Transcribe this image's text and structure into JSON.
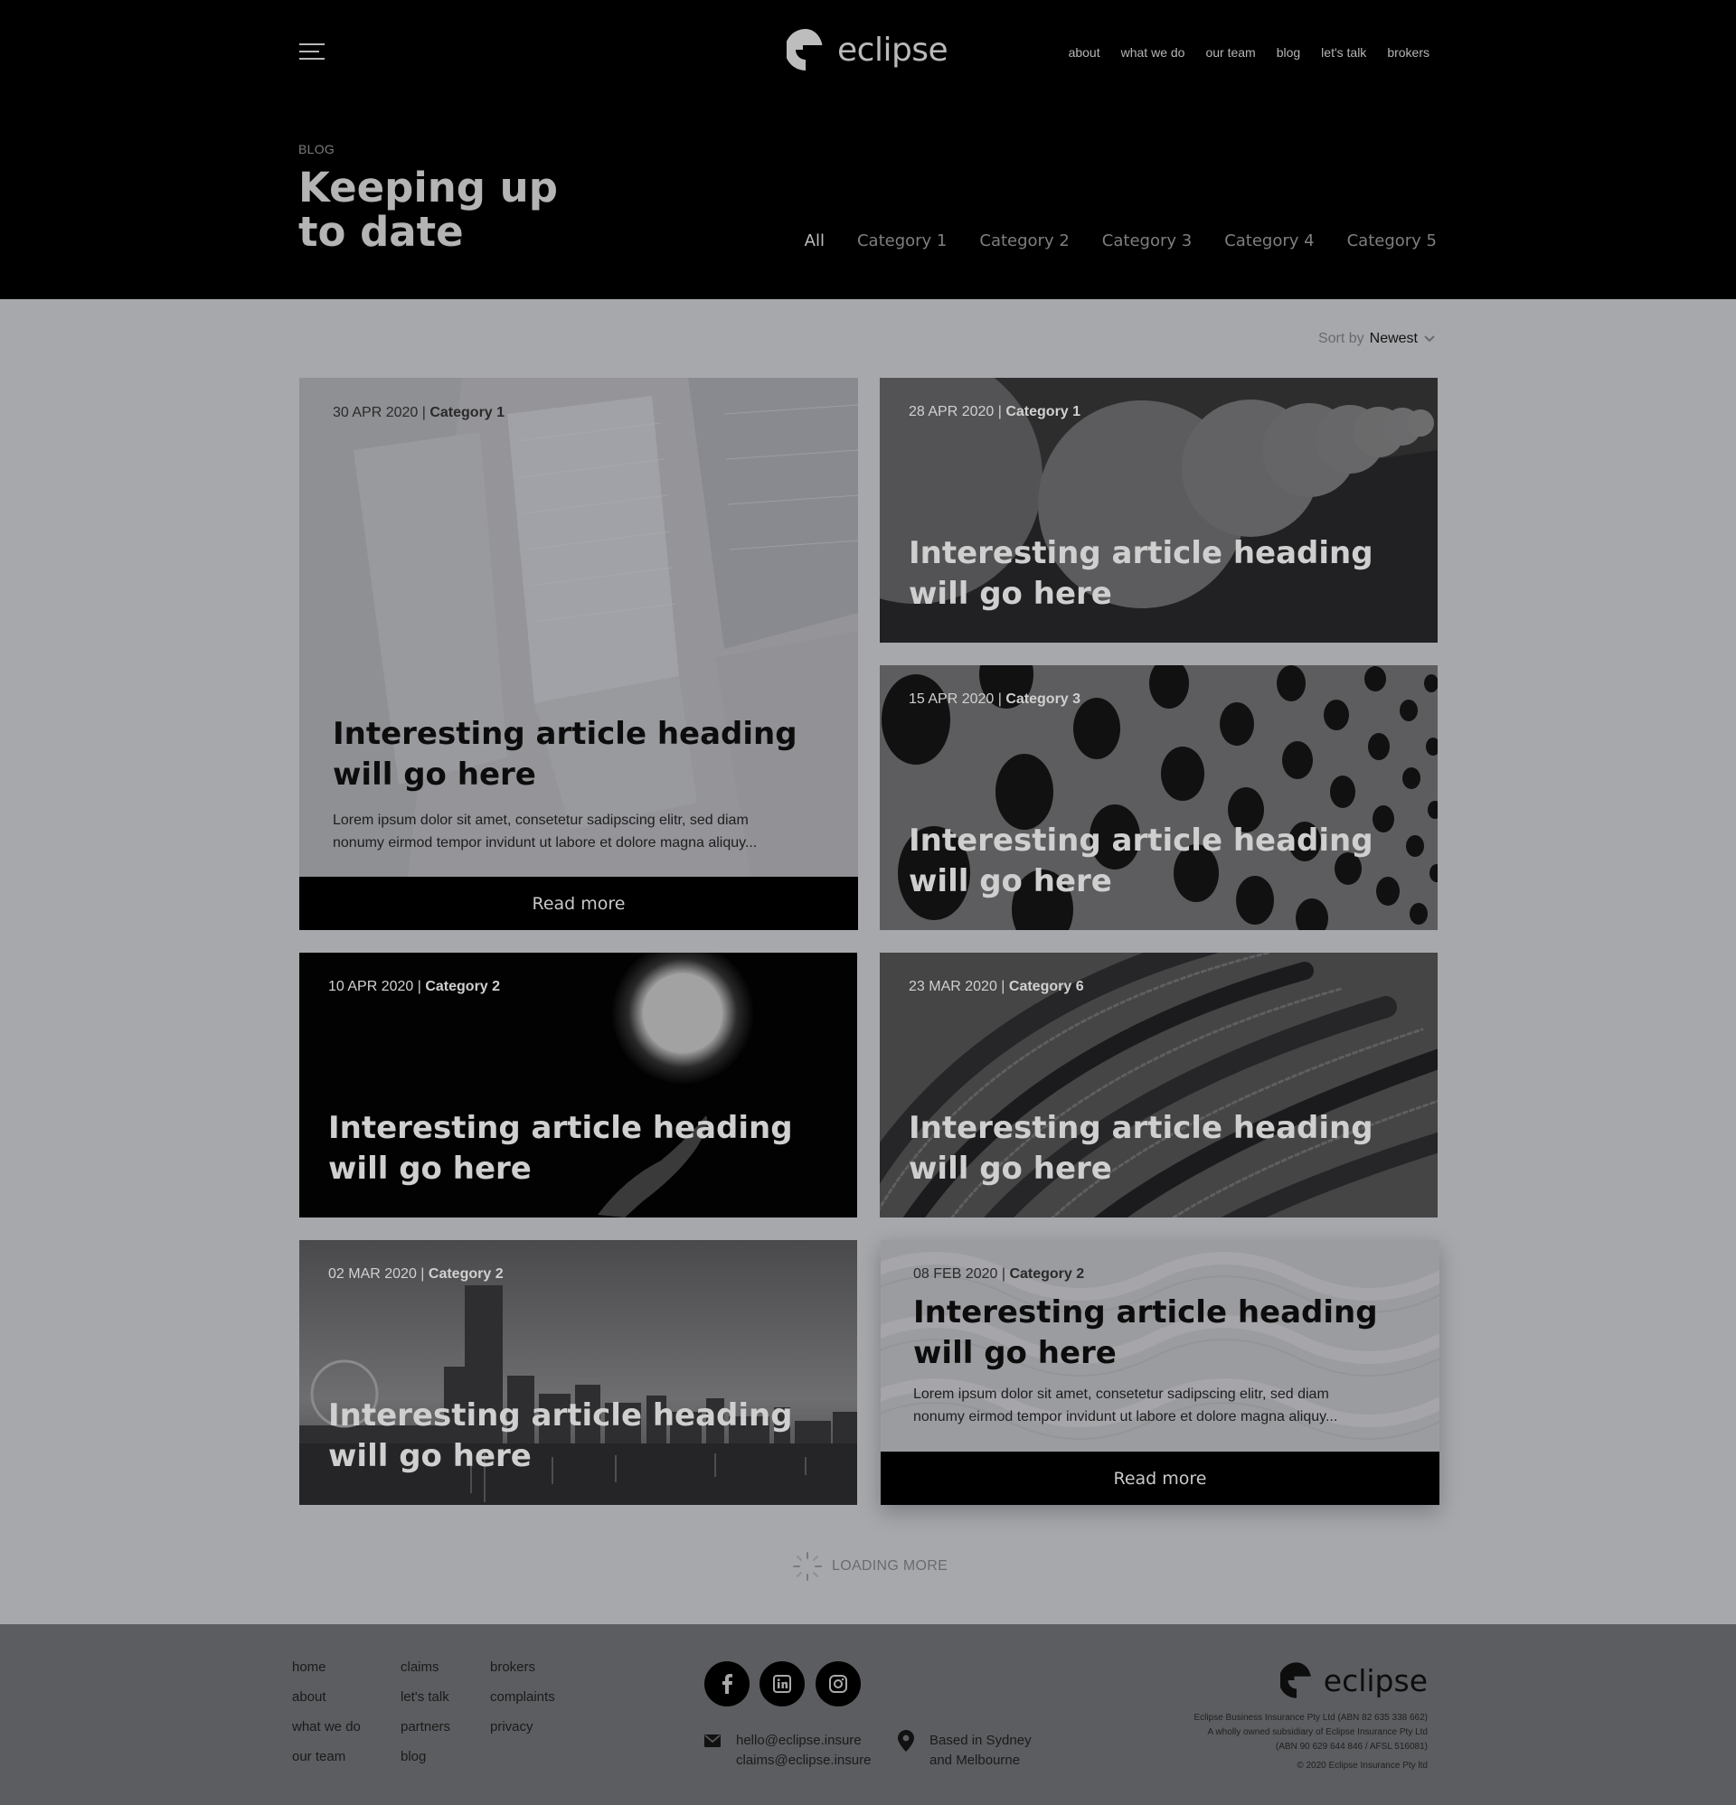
{
  "brand": {
    "name": "eclipse"
  },
  "nav": {
    "items": [
      "about",
      "what we do",
      "our team",
      "blog",
      "let's talk",
      "brokers"
    ]
  },
  "hero": {
    "eyebrow": "BLOG",
    "title_line1": "Keeping up",
    "title_line2": "to date"
  },
  "categories": [
    "All",
    "Category 1",
    "Category 2",
    "Category 3",
    "Category 4",
    "Category 5"
  ],
  "sort": {
    "label": "Sort by",
    "value": "Newest"
  },
  "articles": [
    {
      "date": "30 APR 2020",
      "category": "Category 1",
      "heading_l1": "Interesting article heading",
      "heading_l2": "will go here",
      "excerpt_l1": "Lorem ipsum dolor sit amet, consetetur sadipscing elitr, sed diam",
      "excerpt_l2": "nonumy eirmod tempor invidunt ut labore et dolore magna aliquy...",
      "cta": "Read more"
    },
    {
      "date": "28 APR 2020",
      "category": "Category 1",
      "heading_l1": "Interesting article heading",
      "heading_l2": "will go here"
    },
    {
      "date": "15 APR 2020",
      "category": "Category 3",
      "heading_l1": "Interesting article heading",
      "heading_l2": "will go here"
    },
    {
      "date": "10 APR 2020",
      "category": "Category 2",
      "heading_l1": "Interesting article heading",
      "heading_l2": "will go here"
    },
    {
      "date": "23 MAR 2020",
      "category": "Category 6",
      "heading_l1": "Interesting article heading",
      "heading_l2": "will go here"
    },
    {
      "date": "02 MAR 2020",
      "category": "Category 2",
      "heading_l1": "Interesting article heading",
      "heading_l2": "will go here"
    },
    {
      "date": "08 FEB 2020",
      "category": "Category 2",
      "heading_l1": "Interesting article heading",
      "heading_l2": "will go here",
      "excerpt_l1": "Lorem ipsum dolor sit amet, consetetur sadipscing elitr, sed diam",
      "excerpt_l2": "nonumy eirmod tempor invidunt ut labore et dolore magna aliquy...",
      "cta": "Read more"
    }
  ],
  "loading": "LOADING MORE",
  "footer": {
    "col1": [
      "home",
      "about",
      "what we do",
      "our team"
    ],
    "col2": [
      "claims",
      "let's talk",
      "partners",
      "blog"
    ],
    "col3": [
      "brokers",
      "complaints",
      "privacy"
    ],
    "social_icons": [
      "facebook-icon",
      "linkedin-icon",
      "instagram-icon"
    ],
    "email_1": "hello@eclipse.insure",
    "email_2": "claims@eclipse.insure",
    "location_1": "Based in Sydney",
    "location_2": "and Melbourne",
    "legal_1": "Eclipse Business Insurance Pty Ltd (ABN 82 635 338 662)",
    "legal_2": "A wholly owned subsidiary of Eclipse Insurance Pty Ltd",
    "legal_3": "(ABN 90 629 644 846 / AFSL 516081)",
    "legal_4": "© 2020 Eclipse Insurance Pty ltd"
  },
  "colors": {
    "header_bg": "#000000",
    "page_bg": "#a7a8ac",
    "footer_bg": "#5c5d60"
  }
}
